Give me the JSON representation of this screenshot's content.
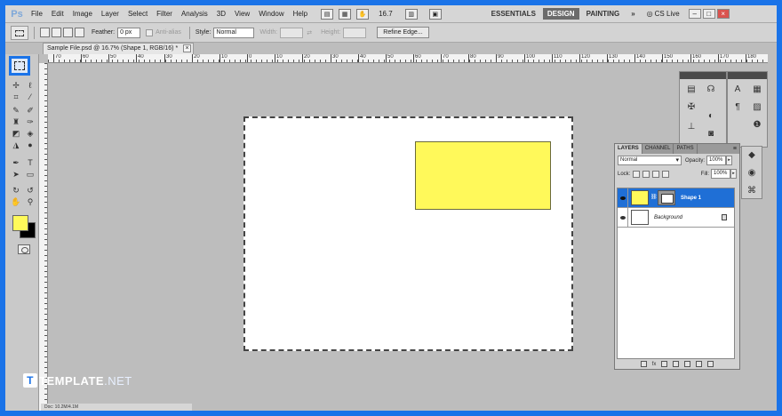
{
  "app": {
    "logo": "Ps"
  },
  "menubar": {
    "items": [
      "File",
      "Edit",
      "Image",
      "Layer",
      "Select",
      "Filter",
      "Analysis",
      "3D",
      "View",
      "Window",
      "Help"
    ],
    "zoom": "16.7",
    "workspaces": [
      "ESSENTIALS",
      "DESIGN",
      "PAINTING"
    ],
    "active_workspace": "DESIGN",
    "more": "»",
    "cslive": "CS Live"
  },
  "options": {
    "feather_label": "Feather:",
    "feather_value": "0 px",
    "antialias_label": "Anti-alias",
    "style_label": "Style:",
    "style_value": "Normal",
    "width_label": "Width:",
    "height_label": "Height:",
    "refine_label": "Refine Edge..."
  },
  "document": {
    "tab_title": "Sample File.psd @ 16.7% (Shape 1, RGB/16) *",
    "close": "×",
    "shape_color": "#fff95a"
  },
  "ruler": {
    "ticks": [
      "70",
      "60",
      "50",
      "40",
      "30",
      "20",
      "10",
      "0",
      "10",
      "20",
      "30",
      "40",
      "50",
      "60",
      "70",
      "80",
      "90",
      "100",
      "110",
      "120",
      "130",
      "140",
      "150",
      "160",
      "170",
      "180"
    ]
  },
  "toolbox": {
    "fg_color": "#fff95a",
    "bg_color": "#000000"
  },
  "layers_panel": {
    "tabs": [
      "LAYERS",
      "CHANNEL",
      "PATHS"
    ],
    "active_tab": "LAYERS",
    "blend_mode": "Normal",
    "opacity_label": "Opacity:",
    "opacity_value": "100%",
    "lock_label": "Lock:",
    "fill_label": "Fill:",
    "fill_value": "100%",
    "layers": [
      {
        "name": "Shape 1",
        "selected": true
      },
      {
        "name": "Background",
        "selected": false
      }
    ]
  },
  "status": {
    "text": "Doc: 10.2M/4.1M"
  },
  "watermark": {
    "badge": "T",
    "brand": "TEMPLATE",
    "suffix": ".NET"
  }
}
